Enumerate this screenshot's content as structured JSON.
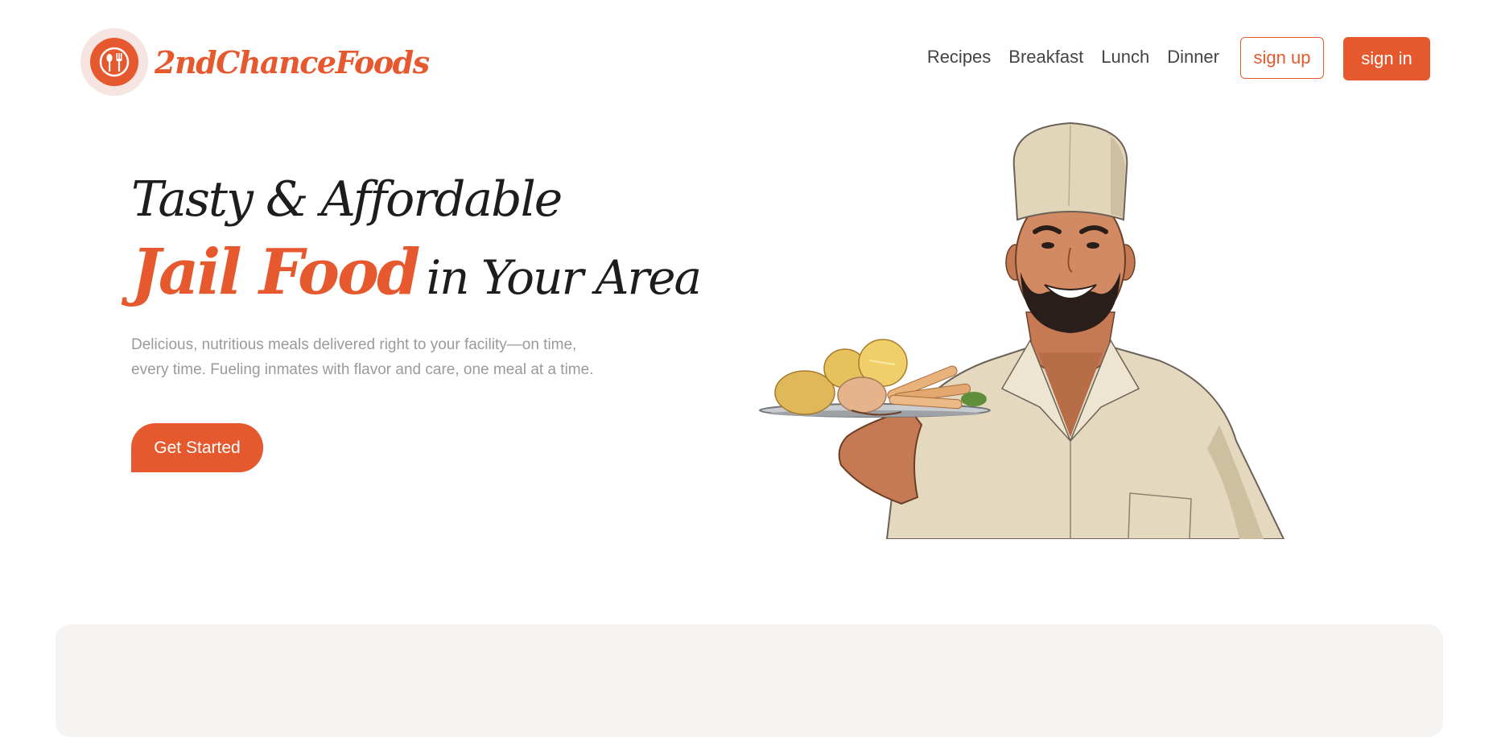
{
  "brand": {
    "name": "2ndChanceFoods",
    "logo_icon": "spoon-fork-icon"
  },
  "nav": {
    "links": [
      "Recipes",
      "Breakfast",
      "Lunch",
      "Dinner"
    ],
    "signup_label": "sign up",
    "signin_label": "sign in"
  },
  "hero": {
    "title_line1": "Tasty & Affordable",
    "title_accent": "Jail Food",
    "title_rest": "in Your Area",
    "description": "Delicious, nutritious meals delivered right to your facility—on time, every time. Fueling inmates with flavor and care, one meal at a time.",
    "cta_label": "Get Started",
    "image": "chef-holding-food-tray-illustration"
  },
  "colors": {
    "accent": "#e6592f",
    "text_dark": "#1d1d1d",
    "text_muted": "#9a9a9a",
    "panel_bg": "#f5f4f2"
  }
}
